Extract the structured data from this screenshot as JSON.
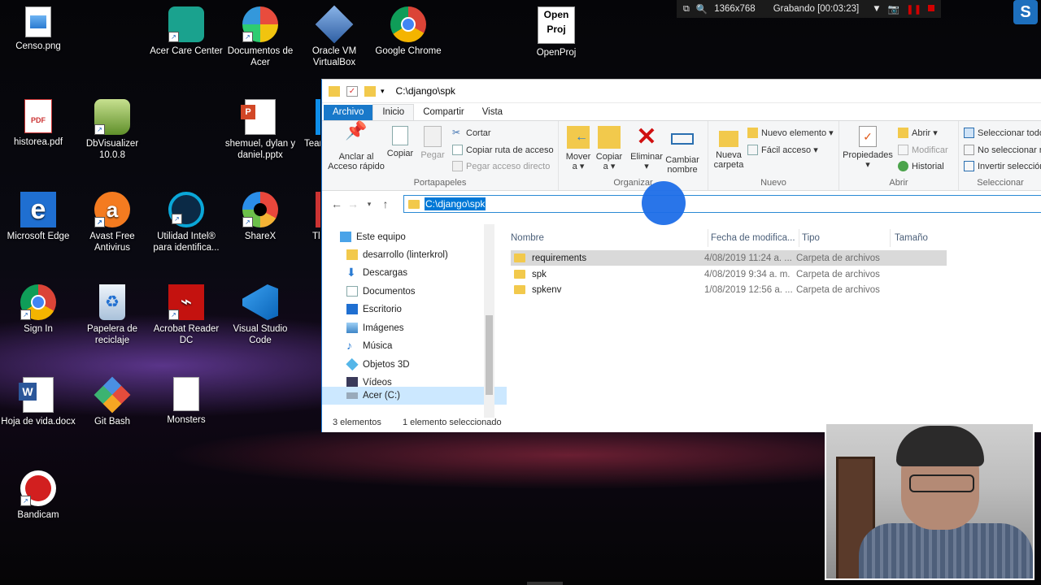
{
  "recording_bar": {
    "resolution": "1366x768",
    "status": "Grabando [00:03:23]"
  },
  "desktop_icons": [
    {
      "label": "Censo.png",
      "icon": "png-image-icon"
    },
    {
      "label": "Acer Care Center",
      "icon": "acer-care-center-icon"
    },
    {
      "label": "Documentos de Acer",
      "icon": "acer-documents-icon"
    },
    {
      "label": "Oracle VM VirtualBox",
      "icon": "virtualbox-icon"
    },
    {
      "label": "Google Chrome",
      "icon": "chrome-icon"
    },
    {
      "label": "OpenProj",
      "icon": "openproj-icon"
    },
    {
      "label": "historea.pdf",
      "icon": "pdf-file-icon"
    },
    {
      "label": "DbVisualizer 10.0.8",
      "icon": "dbvisualizer-icon"
    },
    {
      "label": "shemuel, dylan y daniel.pptx",
      "icon": "pptx-file-icon"
    },
    {
      "label": "Tear",
      "icon": "teamviewer-icon"
    },
    {
      "label": "Microsoft Edge",
      "icon": "edge-icon"
    },
    {
      "label": "Avast Free Antivirus",
      "icon": "avast-icon"
    },
    {
      "label": "Utilidad Intel® para identifica...",
      "icon": "intel-utility-icon"
    },
    {
      "label": "ShareX",
      "icon": "sharex-icon"
    },
    {
      "label": "Tl",
      "icon": "partial-icon"
    },
    {
      "label": "Sign In",
      "icon": "chrome-signin-icon"
    },
    {
      "label": "Papelera de reciclaje",
      "icon": "recycle-bin-icon"
    },
    {
      "label": "Acrobat Reader DC",
      "icon": "acrobat-icon"
    },
    {
      "label": "Visual Studio Code",
      "icon": "vscode-icon"
    },
    {
      "label": "Hoja de vida.docx",
      "icon": "word-file-icon"
    },
    {
      "label": "Git Bash",
      "icon": "git-bash-icon"
    },
    {
      "label": "Monsters",
      "icon": "blank-file-icon"
    },
    {
      "label": "Bandicam",
      "icon": "bandicam-icon"
    }
  ],
  "explorer": {
    "title_path": "C:\\django\\spk",
    "tabs": [
      "Archivo",
      "Inicio",
      "Compartir",
      "Vista"
    ],
    "ribbon": {
      "portapapeles": {
        "title": "Portapapeles",
        "pin": "Anclar al Acceso rápido",
        "copy": "Copiar",
        "paste": "Pegar",
        "cut": "Cortar",
        "copy_path": "Copiar ruta de acceso",
        "paste_shortcut": "Pegar acceso directo"
      },
      "organizar": {
        "title": "Organizar",
        "move": "Mover a",
        "copy_to": "Copiar a",
        "delete": "Eliminar",
        "rename": "Cambiar nombre"
      },
      "nuevo": {
        "title": "Nuevo",
        "new_folder": "Nueva carpeta",
        "new_item": "Nuevo elemento",
        "easy_access": "Fácil acceso"
      },
      "abrir": {
        "title": "Abrir",
        "properties": "Propiedades",
        "open": "Abrir",
        "modify": "Modificar",
        "history": "Historial"
      },
      "seleccionar": {
        "title": "Seleccionar",
        "select_all": "Seleccionar todo",
        "select_none": "No seleccionar ninguno",
        "invert": "Invertir selección"
      }
    },
    "address": "C:\\django\\spk",
    "nav_items": [
      "Este equipo",
      "desarrollo (linterkrol)",
      "Descargas",
      "Documentos",
      "Escritorio",
      "Imágenes",
      "Música",
      "Objetos 3D",
      "Vídeos",
      "Acer (C:)"
    ],
    "columns": [
      "Nombre",
      "Fecha de modifica...",
      "Tipo",
      "Tamaño"
    ],
    "files": [
      {
        "name": "requirements",
        "date": "4/08/2019 11:24 a. ...",
        "type": "Carpeta de archivos"
      },
      {
        "name": "spk",
        "date": "4/08/2019 9:34 a. m.",
        "type": "Carpeta de archivos"
      },
      {
        "name": "spkenv",
        "date": "1/08/2019 12:56 a. ...",
        "type": "Carpeta de archivos"
      }
    ],
    "status": {
      "count": "3 elementos",
      "selected": "1 elemento seleccionado"
    }
  },
  "colors": {
    "accent": "#1979ca",
    "selection": "#0078d7",
    "folder": "#f2c94c",
    "cursor_highlight": "#1e6ee8"
  }
}
